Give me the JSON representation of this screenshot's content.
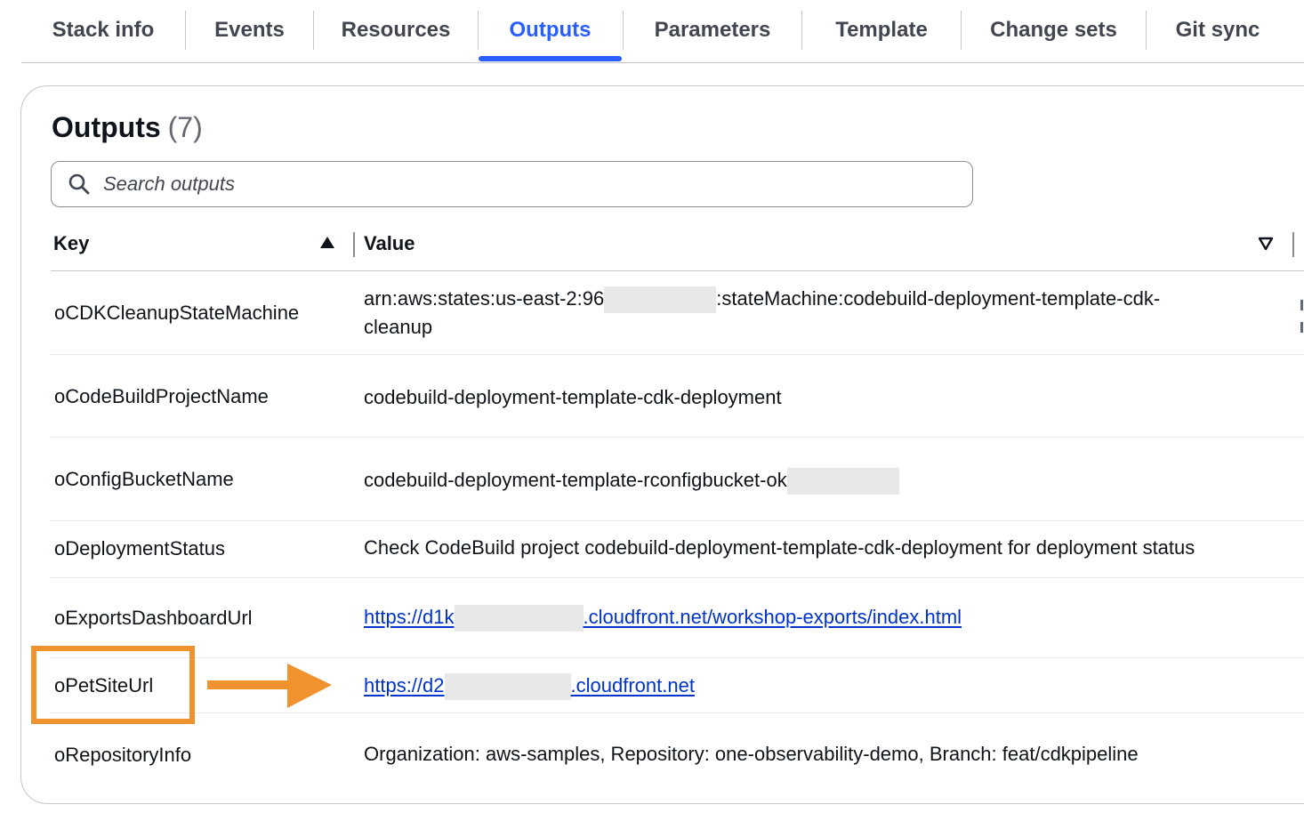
{
  "tabs": [
    {
      "label": "Stack info"
    },
    {
      "label": "Events"
    },
    {
      "label": "Resources"
    },
    {
      "label": "Outputs"
    },
    {
      "label": "Parameters"
    },
    {
      "label": "Template"
    },
    {
      "label": "Change sets"
    },
    {
      "label": "Git sync"
    }
  ],
  "active_tab": "Outputs",
  "panel": {
    "title": "Outputs",
    "count": "(7)"
  },
  "search": {
    "placeholder": "Search outputs",
    "value": ""
  },
  "table": {
    "columns": [
      {
        "label": "Key",
        "sort": "ascending"
      },
      {
        "label": "Value",
        "sort": "descending"
      }
    ],
    "rows": [
      {
        "key": "oCDKCleanupStateMachine",
        "value_prefix": "arn:aws:states:us-east-2:96",
        "value_suffix": ":stateMachine:codebuild-deployment-template-cdk-cleanup",
        "redacted": true,
        "link": false
      },
      {
        "key": "oCodeBuildProjectName",
        "value": "codebuild-deployment-template-cdk-deployment",
        "link": false
      },
      {
        "key": "oConfigBucketName",
        "value_prefix": "codebuild-deployment-template-rconfigbucket-ok",
        "value_suffix": "",
        "redacted": true,
        "link": false
      },
      {
        "key": "oDeploymentStatus",
        "value": "Check CodeBuild project codebuild-deployment-template-cdk-deployment for deployment status",
        "link": false
      },
      {
        "key": "oExportsDashboardUrl",
        "value_prefix": "https://d1k",
        "value_suffix": ".cloudfront.net/workshop-exports/index.html",
        "redacted": true,
        "link": true
      },
      {
        "key": "oPetSiteUrl",
        "value_prefix": "https://d2",
        "value_suffix": ".cloudfront.net",
        "redacted": true,
        "link": true,
        "highlighted": true
      },
      {
        "key": "oRepositoryInfo",
        "value": "Organization: aws-samples, Repository: one-observability-demo, Branch: feat/cdkpipeline",
        "link": false
      }
    ]
  },
  "colors": {
    "accent": "#295eff",
    "link": "#0033cc",
    "annotation": "#f0922e",
    "redaction": "#e8e8e8"
  },
  "icons": {
    "search": "search-icon",
    "sort_asc": "caret-up-filled-icon",
    "sort_desc": "caret-down-outline-icon",
    "annotation_arrow": "arrow-right-icon"
  }
}
